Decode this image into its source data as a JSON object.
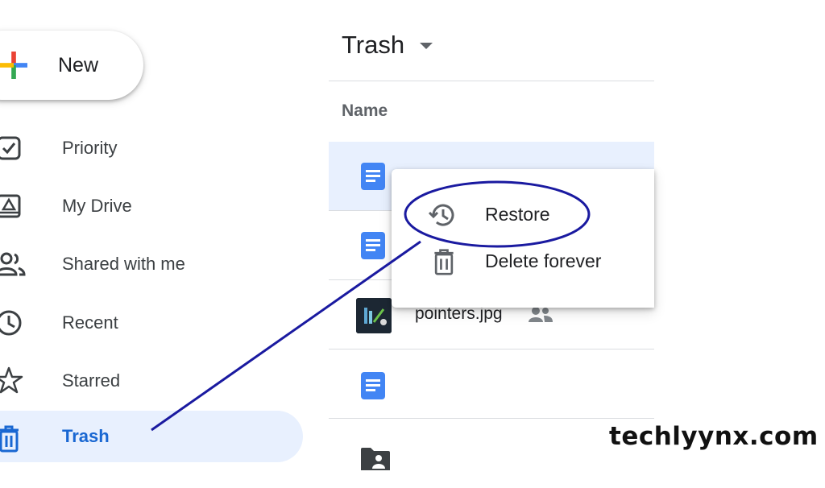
{
  "new_button": {
    "label": "New"
  },
  "sidebar": {
    "items": [
      {
        "label": "Priority",
        "icon": "priority-checkbox-icon"
      },
      {
        "label": "My Drive",
        "icon": "my-drive-icon"
      },
      {
        "label": "Shared with me",
        "icon": "shared-people-icon"
      },
      {
        "label": "Recent",
        "icon": "clock-icon"
      },
      {
        "label": "Starred",
        "icon": "star-icon"
      },
      {
        "label": "Trash",
        "icon": "trash-icon",
        "active": true
      }
    ]
  },
  "main": {
    "title": "Trash",
    "column_header": "Name",
    "files": [
      {
        "name": "",
        "type": "google-doc",
        "selected": true
      },
      {
        "name": "",
        "type": "google-doc"
      },
      {
        "name": "pointers.jpg",
        "type": "image",
        "shared": true
      },
      {
        "name": "",
        "type": "google-doc"
      },
      {
        "name": "",
        "type": "shared-folder"
      }
    ]
  },
  "context_menu": {
    "items": [
      {
        "label": "Restore",
        "icon": "restore-history-icon",
        "highlighted": true
      },
      {
        "label": "Delete forever",
        "icon": "trash-icon"
      }
    ]
  },
  "watermark": "techlyynx.com",
  "colors": {
    "accent_blue": "#1967d2",
    "selection_bg": "#e8f0fe",
    "doc_icon_blue": "#4285f4",
    "annotation_navy": "#1a1aa0"
  }
}
